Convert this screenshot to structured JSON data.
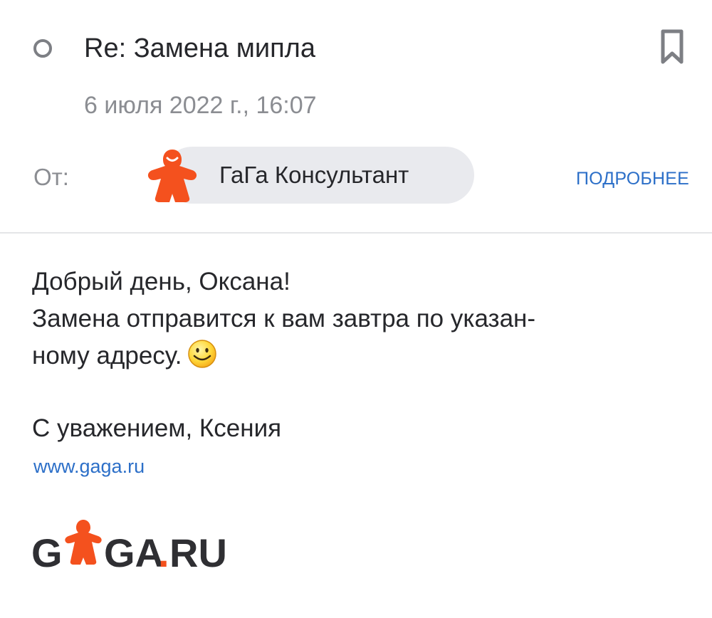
{
  "message": {
    "subject": "Re: Замена мипла",
    "date": "6 июля 2022 г., 16:07",
    "from_label": "От:",
    "sender_name": "ГаГа Консультант",
    "details_label": "ПОДРОБНЕЕ"
  },
  "body": {
    "lines": [
      "Добрый день, Оксана!",
      "Замена отправится к вам завтра по указан-",
      "ному адресу."
    ],
    "signature": "С уважением, Ксения",
    "link": "www.gaga.ru"
  },
  "logo": {
    "text_left": "G",
    "text_right": "GA",
    "text_dot": ".",
    "text_tld": "RU"
  },
  "icons": {
    "unread": "unread-circle-icon",
    "bookmark": "bookmark-icon",
    "avatar": "meeple-avatar-icon",
    "smiley": "smiley-emoji-icon"
  },
  "colors": {
    "brand_orange": "#f4511e",
    "link_blue": "#2c6fc8",
    "muted_gray": "#8b8d92",
    "chip_background": "#e9eaee"
  }
}
